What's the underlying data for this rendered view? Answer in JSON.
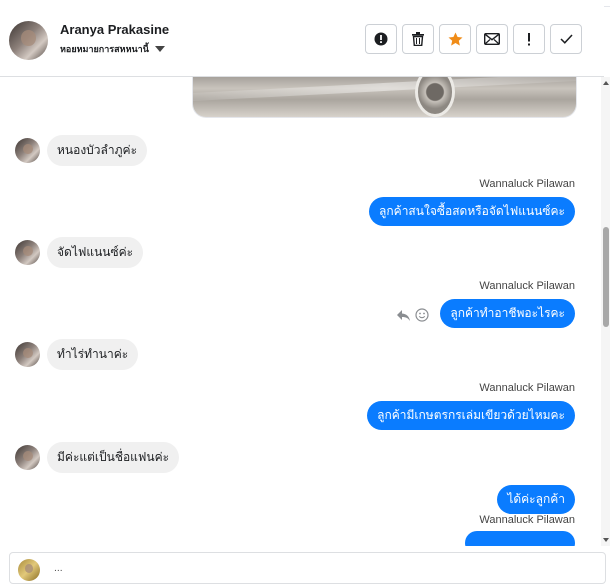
{
  "header": {
    "contact_name": "Aranya Prakasine",
    "subtitle": "หอยหมายการสหหนานี้",
    "tools": [
      {
        "name": "mark-spam-button",
        "icon": "exclamation-circle-icon"
      },
      {
        "name": "delete-button",
        "icon": "trash-icon"
      },
      {
        "name": "star-button",
        "icon": "star-icon"
      },
      {
        "name": "mark-unread-button",
        "icon": "envelope-icon"
      },
      {
        "name": "priority-button",
        "icon": "exclamation-icon"
      },
      {
        "name": "done-button",
        "icon": "check-icon"
      }
    ]
  },
  "colors": {
    "outgoing_bubble": "#0a7cff",
    "incoming_bubble": "#f0f0f0",
    "star": "#f08c18"
  },
  "messages": [
    {
      "direction": "in",
      "text": "หนองบัวลำภูค่ะ"
    },
    {
      "direction": "out",
      "sender": "Wannaluck Pilawan",
      "text": "ลูกค้าสนใจซื้อสดหรือจัดไฟแนนซ์คะ"
    },
    {
      "direction": "in",
      "text": "จัดไฟแนนซ์ค่ะ"
    },
    {
      "direction": "out",
      "sender": "Wannaluck Pilawan",
      "text": "ลูกค้าทำอาชีพอะไรคะ"
    },
    {
      "direction": "in",
      "text": "ทำไร่ทำนาค่ะ"
    },
    {
      "direction": "out",
      "sender": "Wannaluck Pilawan",
      "text": "ลูกค้ามีเกษตรกรเล่มเขียวด้วยไหมคะ"
    },
    {
      "direction": "in",
      "text": "มีค่ะแต่เป็นชื่อแฟนค่ะ"
    },
    {
      "direction": "out",
      "text": "ได้ค่ะลูกค้า"
    },
    {
      "direction": "out",
      "sender": "Wannaluck Pilawan",
      "text": ""
    }
  ],
  "reaction_icons": [
    "reply-icon",
    "smiley-icon"
  ],
  "composer": {
    "text": "..."
  }
}
